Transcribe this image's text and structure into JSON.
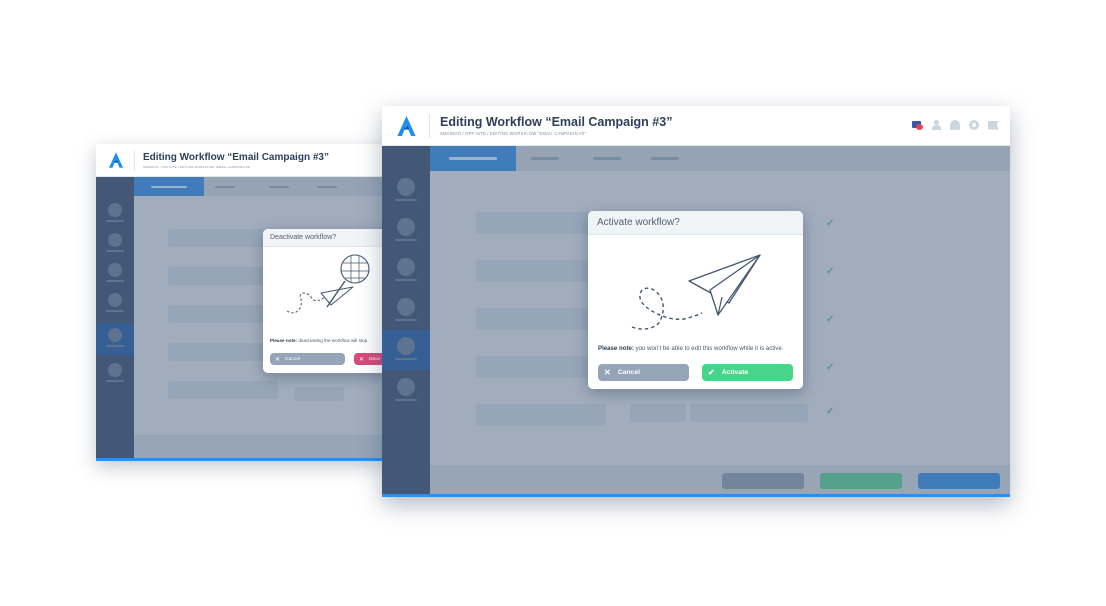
{
  "back": {
    "title": "Editing Workflow “Email Campaign #3”",
    "breadcrumb": "SMAINOO / OFF-SITE / EDITING WORKFLOW “EMAIL CAMPAIGN #3”",
    "modal": {
      "title": "Deactivate workflow?",
      "note_bold": "Please note:",
      "note_text": " deactivating the workflow will stop",
      "cancel_label": "Cancel",
      "confirm_label": "Deac"
    }
  },
  "front": {
    "title": "Editing Workflow “Email Campaign #3”",
    "breadcrumb": "SMAINOO / OFF-SITE / EDITING WORKFLOW “EMAIL CAMPAIGN #3”",
    "modal": {
      "title": "Activate workflow?",
      "note_bold": "Please note:",
      "note_text": " you won't be able to edit this workflow while it is active.",
      "cancel_label": "Cancel",
      "activate_label": "Activate"
    }
  },
  "colors": {
    "brand": "#1e8ff0",
    "activate": "#48d48a",
    "cancel": "#95a5b7",
    "deactivate": "#d64b7a",
    "sidebar": "#3f5573"
  },
  "icons": {
    "back_cancel": "close-icon",
    "front_cancel": "close-icon",
    "front_activate": "check-icon"
  }
}
